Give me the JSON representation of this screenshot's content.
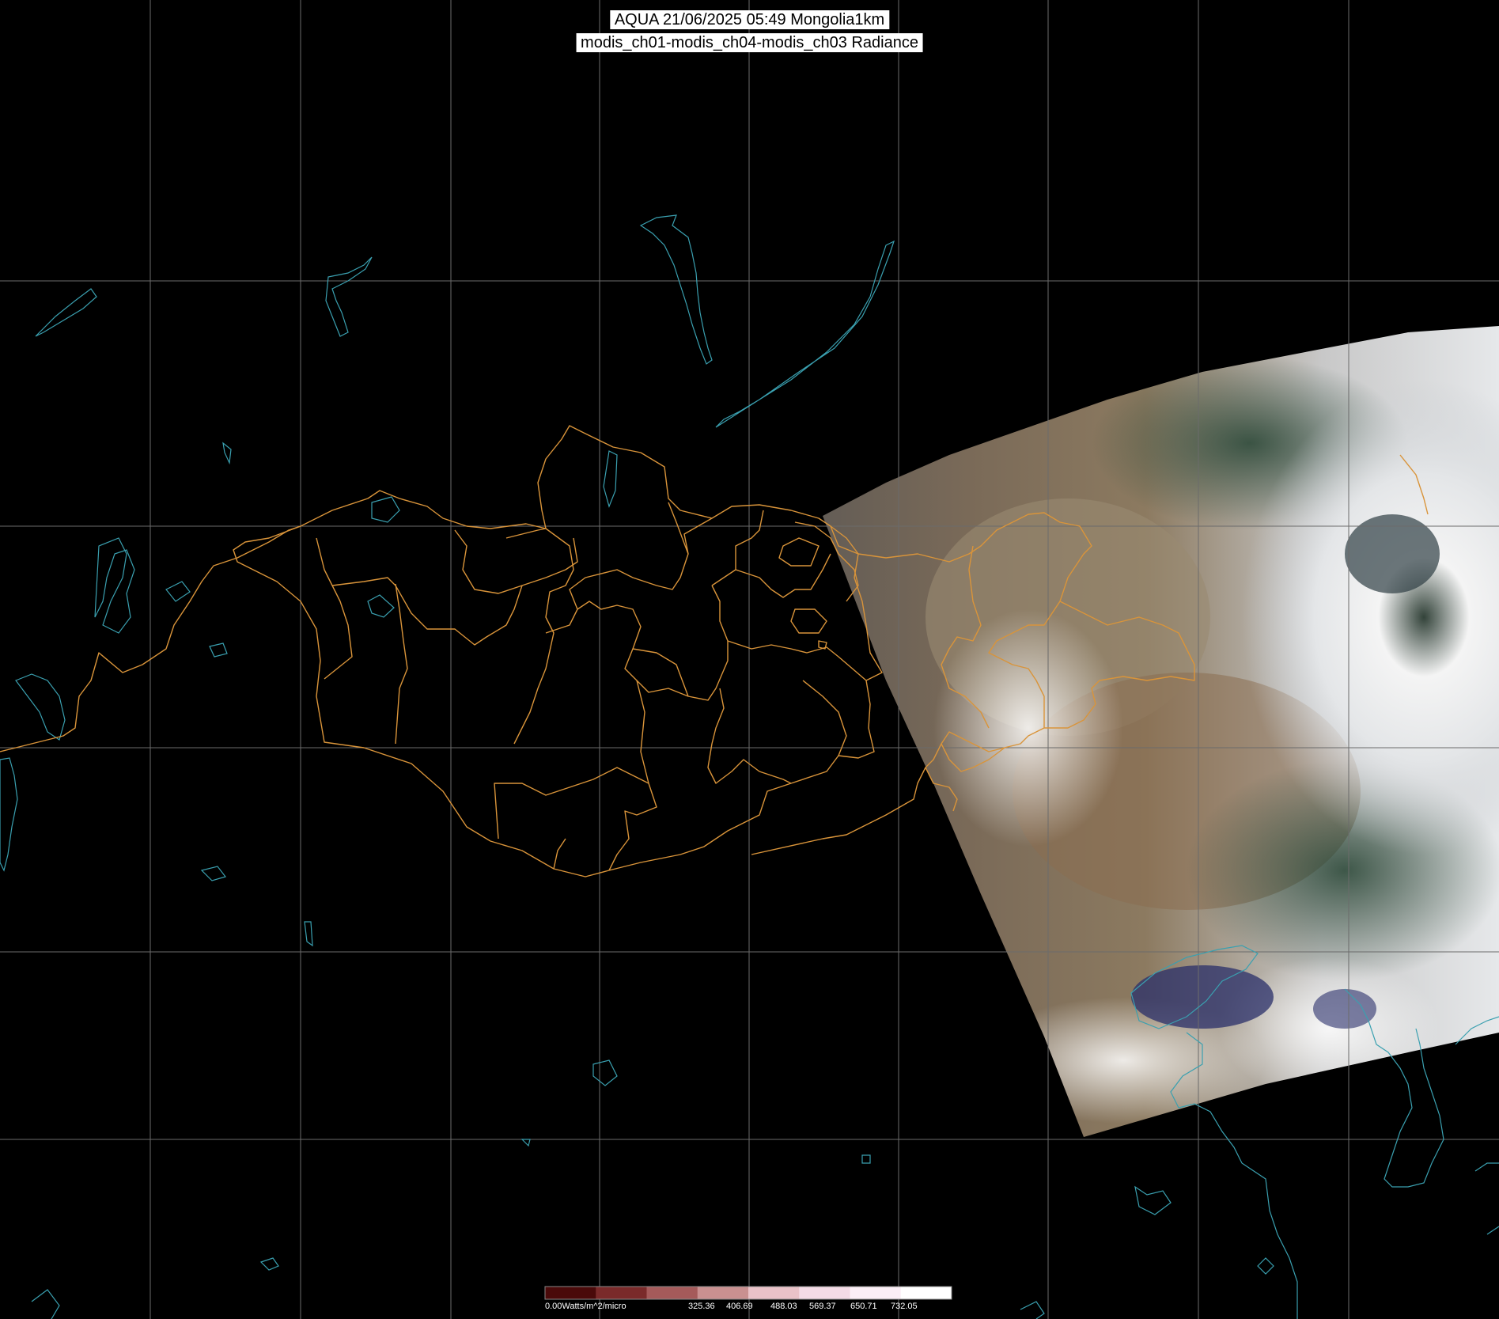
{
  "title": {
    "line1": "AQUA 21/06/2025 05:49 Mongolia1km",
    "line2": "modis_ch01-modis_ch04-modis_ch03 Radiance"
  },
  "legend": {
    "unit_label": "0.00Watts/m^2/micro",
    "ticks": [
      "325.36",
      "406.69",
      "488.03",
      "569.37",
      "650.71",
      "732.05"
    ],
    "colors": [
      "#4a0a0a",
      "#7a2a2a",
      "#a55a5a",
      "#c99090",
      "#e9c2c8",
      "#f4dbe6",
      "#fbeef6",
      "#ffffff"
    ]
  },
  "colors": {
    "background": "#000000",
    "grid": "#6b6b6b",
    "borders": "#d9943a",
    "coast": "#3aa0b0"
  }
}
